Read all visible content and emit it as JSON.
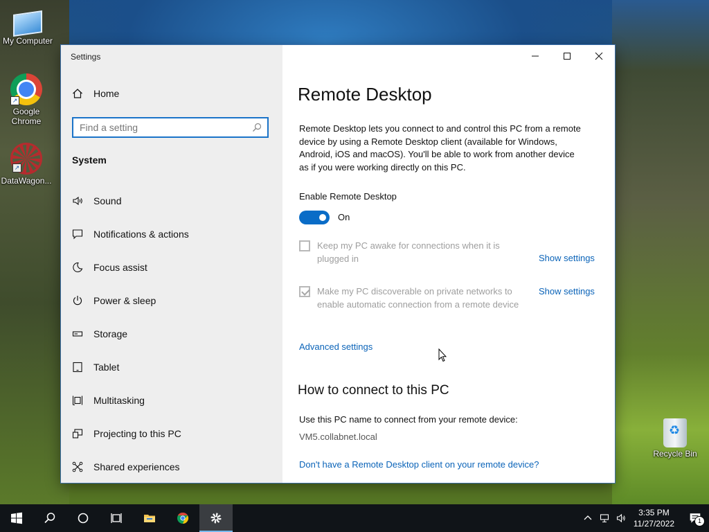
{
  "desktop": {
    "icons": [
      {
        "label": "My Computer",
        "icon": "computer-icon"
      },
      {
        "label": "Google Chrome",
        "icon": "chrome-icon"
      },
      {
        "label": "DataWagon...",
        "icon": "datawagon-icon"
      },
      {
        "label": "Recycle Bin",
        "icon": "recycle-bin-icon"
      }
    ]
  },
  "window": {
    "title": "Settings",
    "controls": {
      "minimize": "minimize-icon",
      "maximize": "maximize-icon",
      "close": "close-icon"
    }
  },
  "sidebar": {
    "home_label": "Home",
    "search_placeholder": "Find a setting",
    "section_title": "System",
    "items": [
      {
        "label": "Sound",
        "icon": "speaker-icon"
      },
      {
        "label": "Notifications & actions",
        "icon": "notification-icon"
      },
      {
        "label": "Focus assist",
        "icon": "moon-icon"
      },
      {
        "label": "Power & sleep",
        "icon": "power-icon"
      },
      {
        "label": "Storage",
        "icon": "storage-icon"
      },
      {
        "label": "Tablet",
        "icon": "tablet-icon"
      },
      {
        "label": "Multitasking",
        "icon": "multitasking-icon"
      },
      {
        "label": "Projecting to this PC",
        "icon": "projecting-icon"
      },
      {
        "label": "Shared experiences",
        "icon": "shared-experiences-icon"
      }
    ]
  },
  "content": {
    "title": "Remote Desktop",
    "description": "Remote Desktop lets you connect to and control this PC from a remote device by using a Remote Desktop client (available for Windows, Android, iOS and macOS). You'll be able to work from another device as if you were working directly on this PC.",
    "enable_label": "Enable Remote Desktop",
    "toggle_state": "On",
    "option_awake": {
      "text": "Keep my PC awake for connections when it is plugged in",
      "checked": false,
      "link": "Show settings"
    },
    "option_discoverable": {
      "text": "Make my PC discoverable on private networks to enable automatic connection from a remote device",
      "checked": true,
      "link": "Show settings"
    },
    "advanced_link": "Advanced settings",
    "how_title": "How to connect to this PC",
    "how_text": "Use this PC name to connect from your remote device:",
    "pc_name": "VM5.collabnet.local",
    "client_link": "Don't have a Remote Desktop client on your remote device?"
  },
  "taskbar": {
    "items": [
      "start-icon",
      "search-icon",
      "cortana-icon",
      "task-view-icon",
      "file-explorer-icon",
      "chrome-icon",
      "settings-icon"
    ],
    "time": "3:35 PM",
    "date": "11/27/2022",
    "notification_count": "1"
  },
  "colors": {
    "accent": "#0a6cc7",
    "link": "#0a63b8",
    "sidebar_bg": "#eeeeee",
    "taskbar_bg": "#101418"
  }
}
